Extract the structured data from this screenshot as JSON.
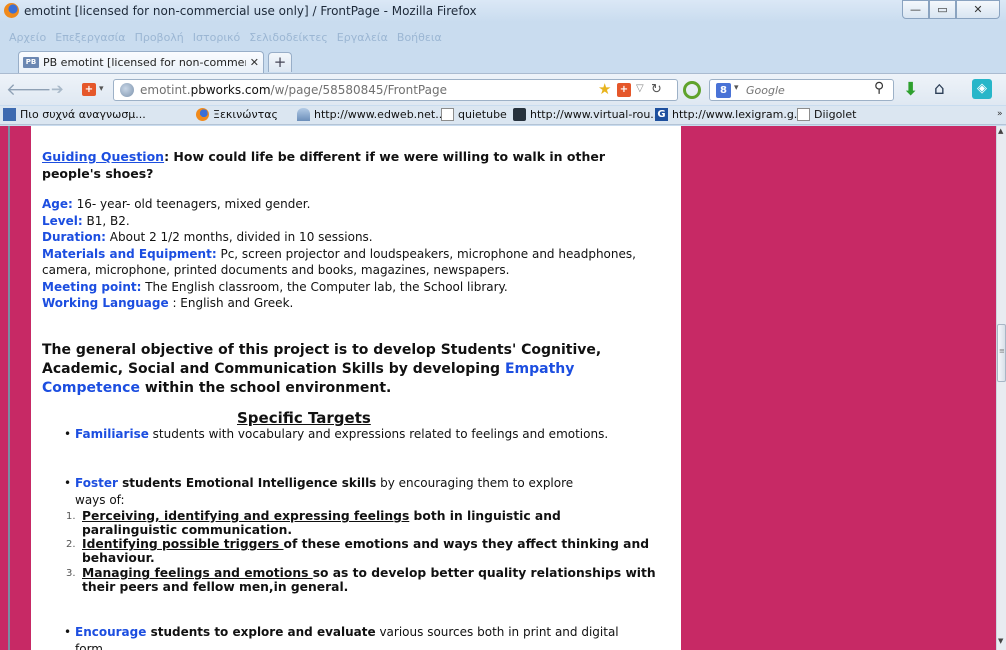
{
  "window": {
    "title": "emotint [licensed for non-commercial use only] / FrontPage - Mozilla Firefox",
    "controls": {
      "minimize": "—",
      "maximize": "▭",
      "close": "✕"
    }
  },
  "menu": [
    "Αρχείο",
    "Επεξεργασία",
    "Προβολή",
    "Ιστορικό",
    "Σελιδοδείκτες",
    "Εργαλεία",
    "Βοήθεια"
  ],
  "tab": {
    "favicon": "PB",
    "title": "PB emotint [licensed for non-commercial us...",
    "close": "✕",
    "new_tab": "+"
  },
  "navbar": {
    "url_plain": "emotint.",
    "url_domain": "pbworks.com",
    "url_path": "/w/page/58580845/FrontPage",
    "search_placeholder": "Google",
    "search_engine_icon": "g-icon"
  },
  "bookmarks": [
    {
      "label": "Πιο συχνά αναγνωσμ...",
      "icon": "rss-icon"
    },
    {
      "label": "Ξεκινώντας",
      "icon": "firefox-icon"
    },
    {
      "label": "http://www.edweb.net...",
      "icon": "hat-icon"
    },
    {
      "label": "quietube",
      "icon": "page-icon"
    },
    {
      "label": "http://www.virtual-rou...",
      "icon": "bus-icon"
    },
    {
      "label": "http://www.lexigram.g...",
      "icon": "lg-icon"
    },
    {
      "label": "Diigolet",
      "icon": "page-icon"
    }
  ],
  "bookmarks_more": "»",
  "page": {
    "guiding": {
      "label": "Guiding Question",
      "text": ": How could life be different if we were willing to walk in other people's shoes?"
    },
    "meta": [
      {
        "label": "Age:",
        "value": " 16- year- old teenagers, mixed gender."
      },
      {
        "label": "Level:",
        "value": " B1, B2."
      },
      {
        "label": "Duration:",
        "value": " About 2 1/2 months, divided in 10 sessions."
      },
      {
        "label": "Materials and Equipment:",
        "value": " Pc, screen projector and loudspeakers, microphone and headphones, camera, microphone, printed documents and books, magazines, newspapers."
      },
      {
        "label": "Meeting point:",
        "value": " The English classroom, the Computer lab, the School library."
      },
      {
        "label": "Working Language",
        "value": " : English and Greek."
      }
    ],
    "objective": {
      "before": "The general objective of this project is to develop Students' Cognitive, Academic, Social and Communication Skills by developing ",
      "highlight": "Empathy Competence",
      "after": " within the school environment."
    },
    "targets_title": "Specific Targets",
    "bullet1": {
      "key": "Familiarise",
      "text": " students with vocabulary and expressions related to feelings and emotions."
    },
    "bullet2": {
      "key": "Foster",
      "bold": " students Emotional Intelligence skills",
      "text": " by encouraging them to explore",
      "cont": "ways of:"
    },
    "ordered": [
      {
        "num": "1.",
        "underlined": "Perceiving, identifying and expressing feelings",
        "rest": " both in linguistic and paralinguistic communication."
      },
      {
        "num": "2.",
        "underlined": "Identifying possible triggers ",
        "rest": "of these emotions and ways they affect thinking and behaviour."
      },
      {
        "num": "3.",
        "underlined": "Managing feelings and emotions ",
        "rest": "so as to develop better quality relationships with their peers and fellow men,in general."
      }
    ],
    "bullet3": {
      "key": "Encourage",
      "bold": " students to explore and evaluate",
      "text": " various sources both in print and digital form."
    },
    "bullet_char": "•"
  },
  "colors": {
    "page_bg": "#c72965",
    "accent_blue": "#1c4ee0"
  }
}
